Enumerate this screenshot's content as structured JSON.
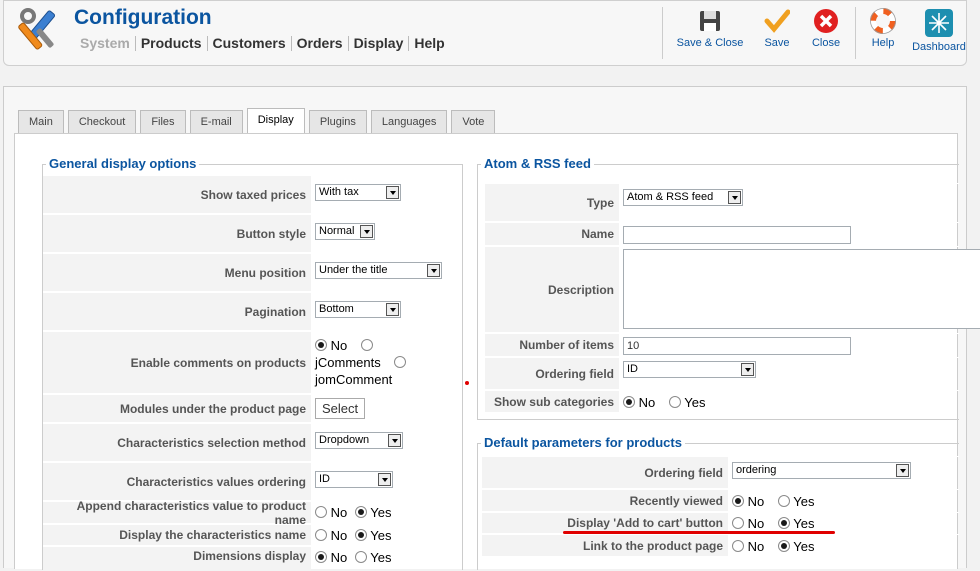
{
  "header": {
    "title": "Configuration",
    "menu": [
      "System",
      "Products",
      "Customers",
      "Orders",
      "Display",
      "Help"
    ]
  },
  "toolbar": {
    "save_close": "Save & Close",
    "save": "Save",
    "close": "Close",
    "help": "Help",
    "dashboard": "Dashboard"
  },
  "tabs": [
    "Main",
    "Checkout",
    "Files",
    "E-mail",
    "Display",
    "Plugins",
    "Languages",
    "Vote"
  ],
  "general": {
    "legend": "General display options",
    "show_taxed_prices": {
      "label": "Show taxed prices",
      "value": "With tax"
    },
    "button_style": {
      "label": "Button style",
      "value": "Normal"
    },
    "menu_position": {
      "label": "Menu position",
      "value": "Under the title"
    },
    "pagination": {
      "label": "Pagination",
      "value": "Bottom"
    },
    "enable_comments": {
      "label": "Enable comments on products",
      "opt_no": "No",
      "opt_jcomments": "jComments",
      "opt_jomcomment": "jomComment"
    },
    "modules": {
      "label": "Modules under the product page",
      "button": "Select"
    },
    "char_method": {
      "label": "Characteristics selection method",
      "value": "Dropdown"
    },
    "char_ordering": {
      "label": "Characteristics values ordering",
      "value": "ID"
    },
    "append_char": {
      "label": "Append characteristics value to product name"
    },
    "display_char_name": {
      "label": "Display the characteristics name"
    },
    "dimensions": {
      "label": "Dimensions display"
    },
    "no": "No",
    "yes": "Yes"
  },
  "feed": {
    "legend": "Atom & RSS feed",
    "type": {
      "label": "Type",
      "value": "Atom & RSS feed"
    },
    "name": {
      "label": "Name",
      "value": ""
    },
    "description": {
      "label": "Description",
      "value": ""
    },
    "number_items": {
      "label": "Number of items",
      "value": "10"
    },
    "ordering": {
      "label": "Ordering field",
      "value": "ID"
    },
    "sub_categories": {
      "label": "Show sub categories"
    },
    "no": "No",
    "yes": "Yes"
  },
  "defaults": {
    "legend": "Default parameters for products",
    "ordering": {
      "label": "Ordering field",
      "value": "ordering"
    },
    "recently_viewed": {
      "label": "Recently viewed"
    },
    "add_to_cart": {
      "label": "Display 'Add to cart' button"
    },
    "link_product": {
      "label": "Link to the product page"
    },
    "no": "No",
    "yes": "Yes"
  },
  "colors": {
    "accent": "#0b55a0",
    "highlight": "#e00000"
  }
}
